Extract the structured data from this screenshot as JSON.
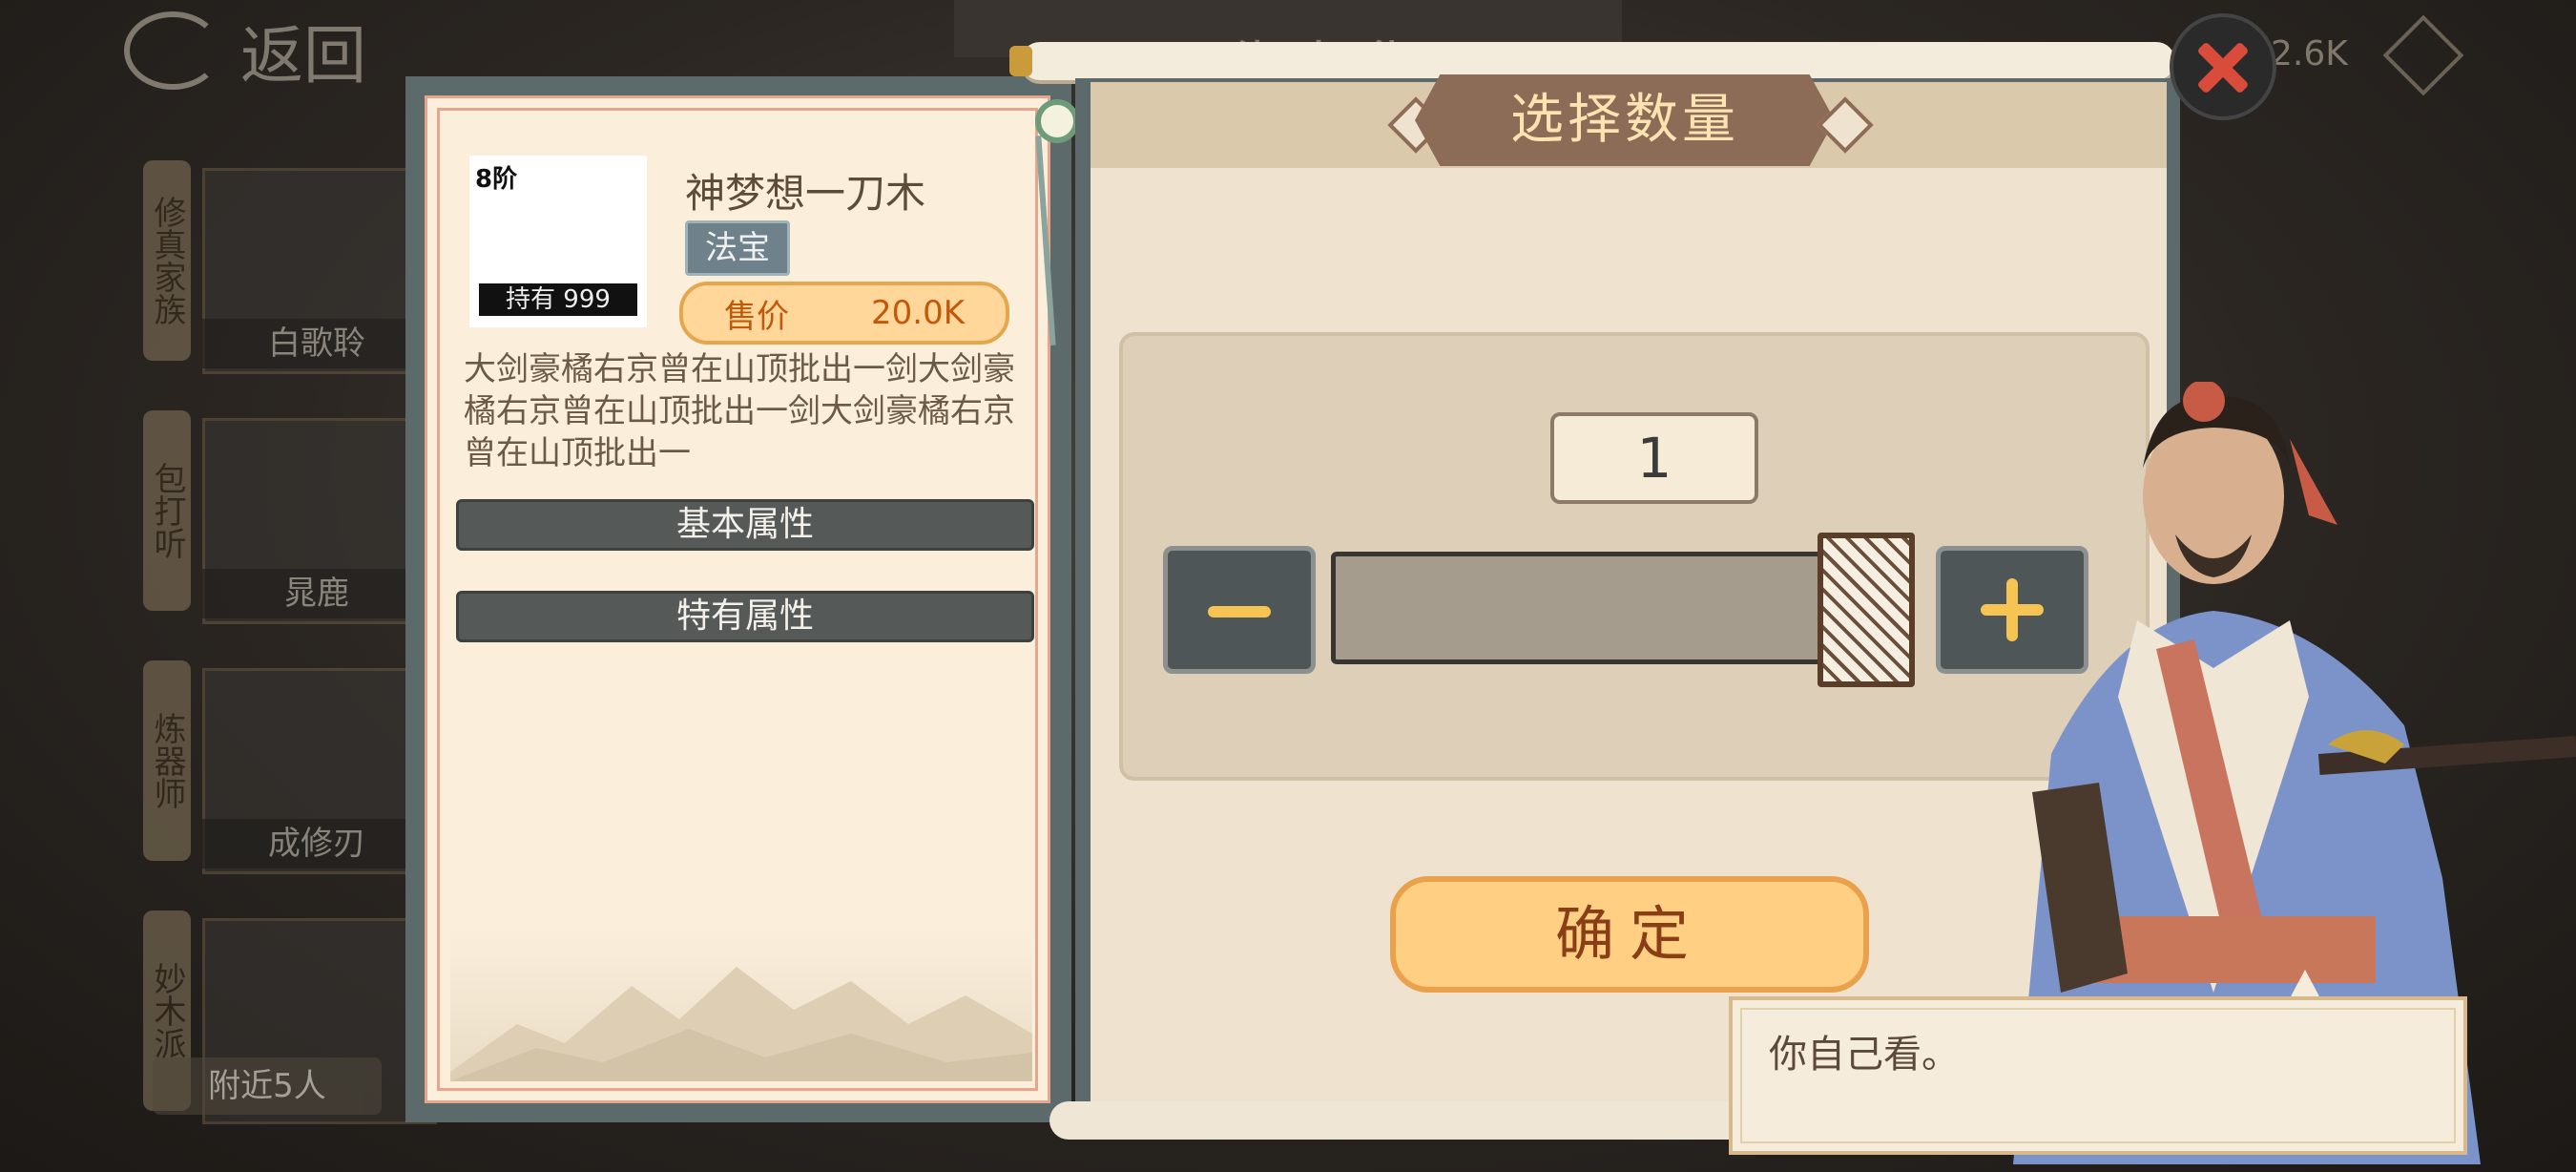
{
  "header": {
    "back_label": "返回",
    "shop_title": "西街杂货",
    "currency_value": "2.6K"
  },
  "npc_list": {
    "items": [
      {
        "tab": "修真家族",
        "name": "白歌聆"
      },
      {
        "tab": "包打听",
        "name": "晁鹿"
      },
      {
        "tab": "炼器师",
        "name": "成修刃"
      },
      {
        "tab": "妙木派",
        "name": ""
      }
    ],
    "nearby_label": "附近5人"
  },
  "item": {
    "tier": "8阶",
    "owned": "持有 999",
    "name": "神梦想一刀木",
    "type": "法宝",
    "price_label": "售价",
    "price_value": "20.0K",
    "description": "大剑豪橘右京曾在山顶批出一剑大剑豪橘右京曾在山顶批出一剑大剑豪橘右京曾在山顶批出一",
    "basic_attr_label": "基本属性",
    "special_attr_label": "特有属性"
  },
  "quantity": {
    "title": "选择数量",
    "value": "1",
    "slider_fraction": 1.0,
    "confirm_label": "确定"
  },
  "dialog": {
    "text": "你自己看。"
  },
  "colors": {
    "accent": "#f5c453",
    "close": "#d94b3b",
    "confirm_bg": "#ffcf84"
  }
}
